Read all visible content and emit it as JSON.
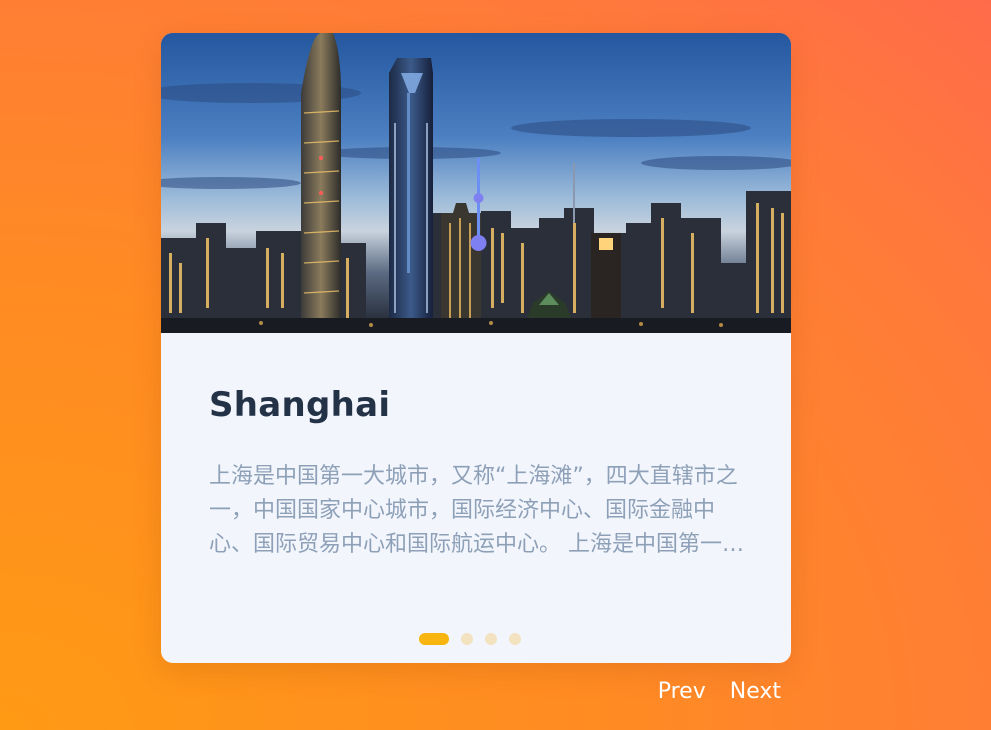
{
  "card": {
    "image_alt": "Shanghai skyline at dusk",
    "title": "Shanghai",
    "description": "上海是中国第一大城市，又称“上海滩”，四大直辖市之一，中国国家中心城市，国际经济中心、国际金融中心、国际贸易中心和国际航运中心。 上海是中国第一大城市，又称“上海滩”……"
  },
  "pagination": {
    "total": 4,
    "active_index": 0,
    "active_color": "#f9b50f",
    "inactive_color": "#f3e2c0"
  },
  "nav": {
    "prev_label": "Prev",
    "next_label": "Next"
  },
  "colors": {
    "background_start": "#ff9a14",
    "background_end": "#ff6b4a",
    "card_bg": "#f2f6fc",
    "title": "#243247",
    "description": "#8ea0b8"
  }
}
